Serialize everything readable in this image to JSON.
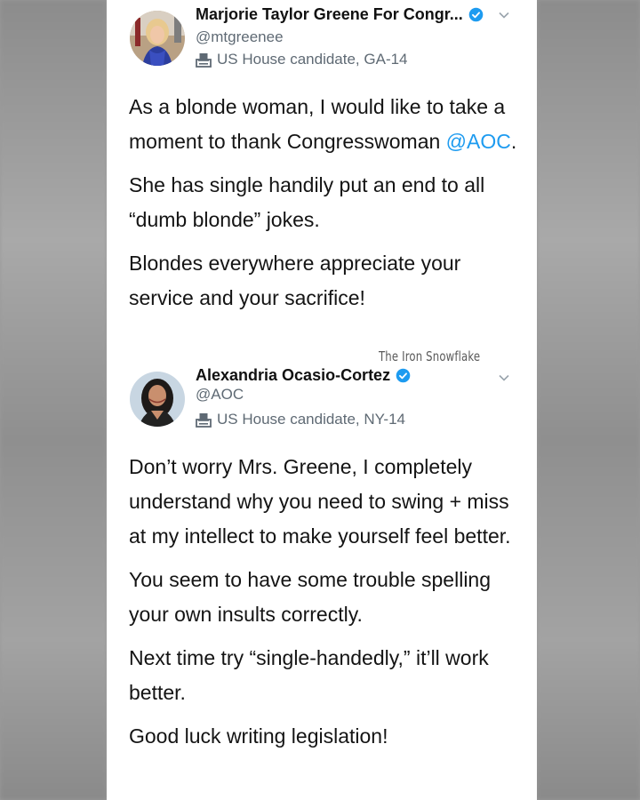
{
  "tweets": [
    {
      "display_name": "Marjorie Taylor Greene For Congr...",
      "handle": "@mtgreenee",
      "label": "US House candidate, GA-14",
      "paragraphs": [
        {
          "before": "As a blonde woman, I would like to take a moment to thank Congresswoman ",
          "mention": "@AOC",
          "after": "."
        },
        {
          "text": "She has single handily put an end to all “dumb blonde” jokes."
        },
        {
          "text": "Blondes everywhere appreciate your service and your sacrifice!"
        }
      ]
    },
    {
      "display_name": "Alexandria Ocasio-Cortez",
      "handle": "@AOC",
      "label": "US House candidate, NY-14",
      "paragraphs": [
        {
          "text": "Don’t worry Mrs. Greene, I completely understand why you need to swing + miss at my intellect to make yourself feel better."
        },
        {
          "text": "You seem to have some trouble spelling your own insults correctly."
        },
        {
          "text": "Next time try “single-handedly,” it’ll work better."
        },
        {
          "text": "Good luck writing legislation!"
        }
      ]
    }
  ],
  "watermark": "The Iron Snowflake",
  "icons": {
    "verified": "verified-badge-icon",
    "chevron": "chevron-down-icon",
    "ballot": "ballot-box-icon"
  },
  "colors": {
    "verified_blue": "#1d9bf0",
    "mention_blue": "#1d9bf0",
    "secondary_text": "#5f6a74"
  }
}
